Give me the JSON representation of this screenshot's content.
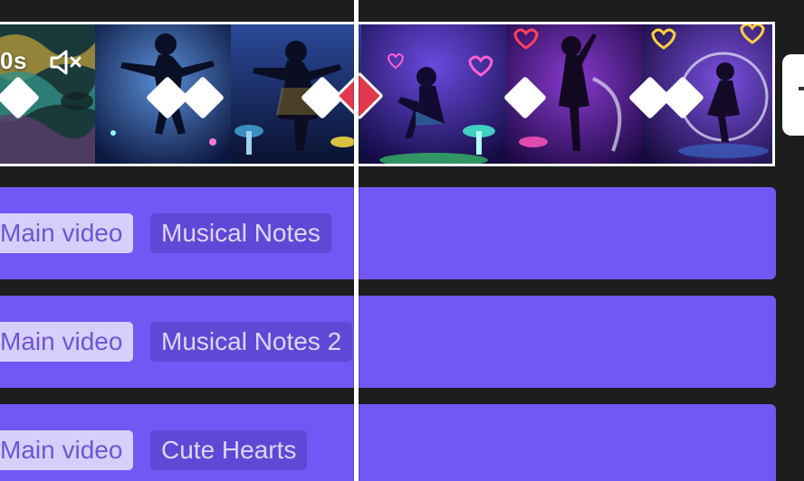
{
  "video_track": {
    "duration_label": "0s",
    "mute_icon": "speaker-muted-icon",
    "thumbnail_count": 6,
    "keyframe_count": 8,
    "active_keyframe_color": "#e0394f"
  },
  "overlay_tracks": [
    {
      "source_label": "Main video",
      "effect_label": "Musical Notes"
    },
    {
      "source_label": "Main video",
      "effect_label": "Musical Notes 2"
    },
    {
      "source_label": "Main video",
      "effect_label": "Cute Hearts"
    }
  ],
  "colors": {
    "background": "#1d1d1d",
    "track": "#7357f4",
    "chip_main_bg": "#d7cffb",
    "chip_effect_bg": "#6048d6",
    "playhead": "#ffffff"
  }
}
